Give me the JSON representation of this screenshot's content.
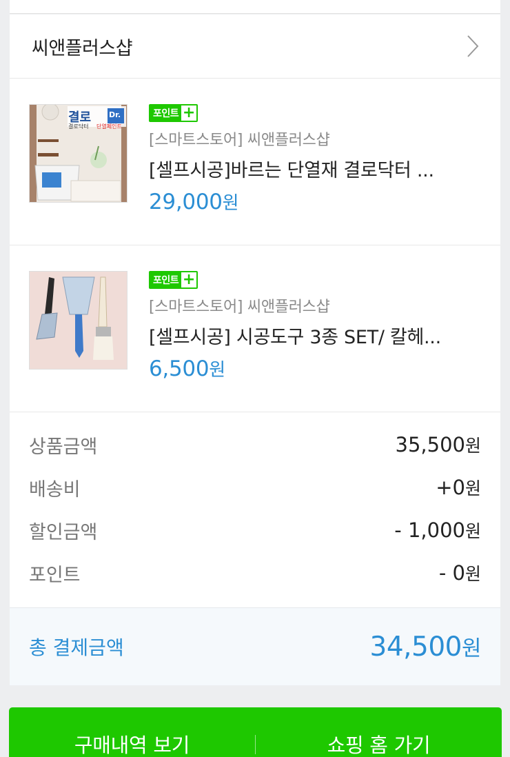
{
  "store": {
    "name": "씨앤플러스샵"
  },
  "products": [
    {
      "badge": "포인트",
      "seller": "[스마트스토어] 씨앤플러스샵",
      "title": "[셀프시공]바르는 단열재 결로닥터 ...",
      "price": "29,000",
      "currency": "원",
      "thumb": {
        "brand_big": "결로",
        "brand_dr": "Dr.",
        "brand_sub": "결로닥터",
        "brand_tag": "단열페인트"
      }
    },
    {
      "badge": "포인트",
      "seller": "[스마트스토어] 씨앤플러스샵",
      "title": "[셀프시공] 시공도구 3종 SET/ 칼헤...",
      "price": "6,500",
      "currency": "원"
    }
  ],
  "summary": {
    "rows": [
      {
        "label": "상품금액",
        "value": "35,500",
        "currency": "원"
      },
      {
        "label": "배송비",
        "value": "+0",
        "currency": "원"
      },
      {
        "label": "할인금액",
        "value": "- 1,000",
        "currency": "원"
      },
      {
        "label": "포인트",
        "value": "- 0",
        "currency": "원"
      }
    ],
    "total_label": "총 결제금액",
    "total_value": "34,500",
    "total_currency": "원"
  },
  "actions": {
    "history_label": "구매내역 보기",
    "shopping_home_label": "쇼핑 홈 가기"
  },
  "colors": {
    "accent_green": "#1ec800",
    "price_blue": "#2b8ed4"
  }
}
